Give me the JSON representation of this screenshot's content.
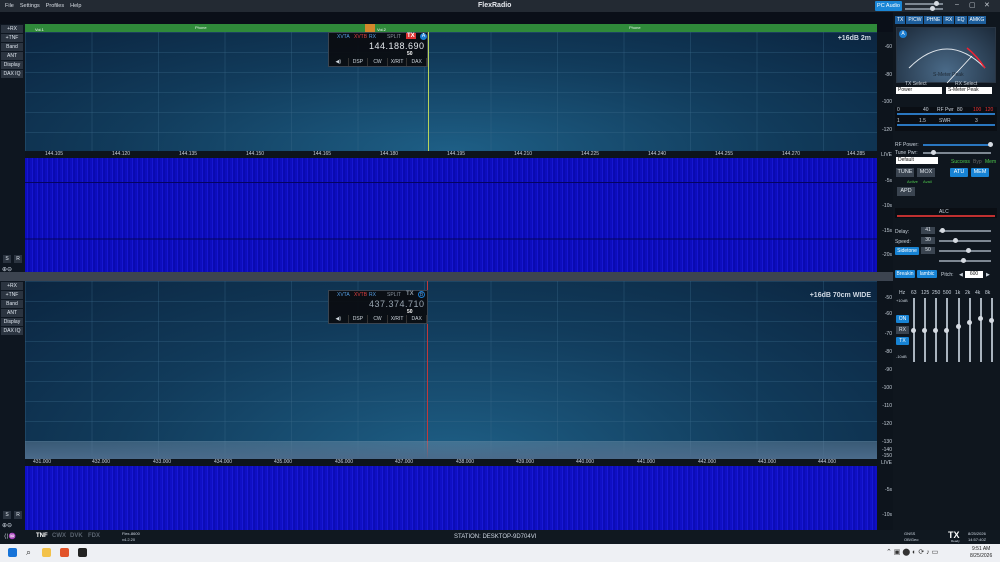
{
  "menu": {
    "file": "File",
    "settings": "Settings",
    "profiles": "Profiles",
    "help": "Help"
  },
  "app_title": "FlexRadio",
  "pc_audio": "PC Audio",
  "pan1": {
    "band_label": "Phone",
    "band_label2": "Phone",
    "seg_left": "Voi.1",
    "seg_right": "Voi.2",
    "info": "+16dB  2m",
    "slice_letter": "A",
    "xvta": "XVTA",
    "xvtb": "XVTB",
    "mode": "RX",
    "split": "SPLIT",
    "tx": "TX",
    "freq": "144.188.690",
    "smeter": "50",
    "dsp": "DSP",
    "cw": "CW",
    "xrit": "X/RIT",
    "dax": "DAX",
    "freqs": [
      "144.105",
      "144.120",
      "144.135",
      "144.150",
      "144.165",
      "144.180",
      "144.195",
      "144.210",
      "144.225",
      "144.240",
      "144.255",
      "144.270",
      "144.285"
    ],
    "dbs": [
      "-60",
      "-80",
      "-100",
      "-120"
    ],
    "wf_times": [
      "LIVE",
      "-5s",
      "-10s",
      "-15s",
      "-20s"
    ]
  },
  "pan2": {
    "info": "+16dB  70cm  WIDE",
    "slice_letter": "B",
    "xvta": "XVTA",
    "xvtb": "XVTB",
    "mode": "RX",
    "split": "SPLIT",
    "tx": "TX",
    "freq": "437.374.710",
    "smeter": "50",
    "dsp": "DSP",
    "cw": "CW",
    "xrit": "X/RIT",
    "dax": "DAX",
    "freqs": [
      "431.000",
      "432.000",
      "433.000",
      "434.000",
      "435.000",
      "436.000",
      "437.000",
      "438.000",
      "439.000",
      "440.000",
      "441.000",
      "442.000",
      "443.000",
      "444.000"
    ],
    "dbs": [
      "-50",
      "-60",
      "-70",
      "-80",
      "-90",
      "-100",
      "-110",
      "-120",
      "-130",
      "-140",
      "-150"
    ],
    "wf_times": [
      "LIVE",
      "-5s",
      "-10s"
    ]
  },
  "leftbar": [
    "+RX",
    "+TNF",
    "Band",
    "ANT",
    "Display",
    "DAX IQ"
  ],
  "leftbar_small": [
    "S",
    "R"
  ],
  "right_tabs": [
    "TX",
    "P/CW",
    "PHNE",
    "RX",
    "EQ",
    "AMKG"
  ],
  "meter": {
    "tx_select": "TX Select",
    "rx_select": "RX Select",
    "tx_value": "Power",
    "rx_value": "S-Meter Peak",
    "label": "S-Meter Peak"
  },
  "power_labels": [
    "0",
    "40",
    "RF Pwr",
    "80",
    "100",
    "120"
  ],
  "swr_labels": [
    "1",
    "1.5",
    "SWR",
    "3"
  ],
  "tx": {
    "rf_power": "RF Power:",
    "tune_power": "Tune Pwr:",
    "profile": "Default",
    "success": "Success",
    "byp": "Byp",
    "mem": "Mem",
    "tune": "TUNE",
    "mox": "MOX",
    "atu": "ATU",
    "memb": "MEM",
    "apd": "APD",
    "active": "Active",
    "avail": "Avail"
  },
  "alc": "ALC",
  "cw": {
    "delay": "Delay:",
    "delay_v": "41",
    "speed": "Speed:",
    "speed_v": "30",
    "sidetone": "Sidetone",
    "sidetone_v": "50",
    "breakin": "Breakin",
    "iambic": "Iambic",
    "pitch": "Pitch:",
    "pitch_v": "600"
  },
  "eq": {
    "bands": [
      "Hz",
      "63",
      "125",
      "250",
      "500",
      "1k",
      "2k",
      "4k",
      "8k"
    ],
    "on": "ON",
    "rx": "RX",
    "tx": "TX",
    "top": "+10dB",
    "mid": "0dB",
    "bottom": "-10dB"
  },
  "status": {
    "tnf": "TNF",
    "cwx": "CWX",
    "dvk": "DVK",
    "fdx": "FDX",
    "model": "Flex-8600",
    "version": "v4.2.20",
    "station": "STATION: DESKTOP-9D704VI",
    "gnss": "GNSS",
    "gps_text": "OB/Geo",
    "tx_badge": "TX",
    "ready": "Ready",
    "date": "8/25/2026",
    "time": "14:57:40Z"
  },
  "taskbar": {
    "time": "9:51 AM",
    "date": "8/25/2026"
  }
}
